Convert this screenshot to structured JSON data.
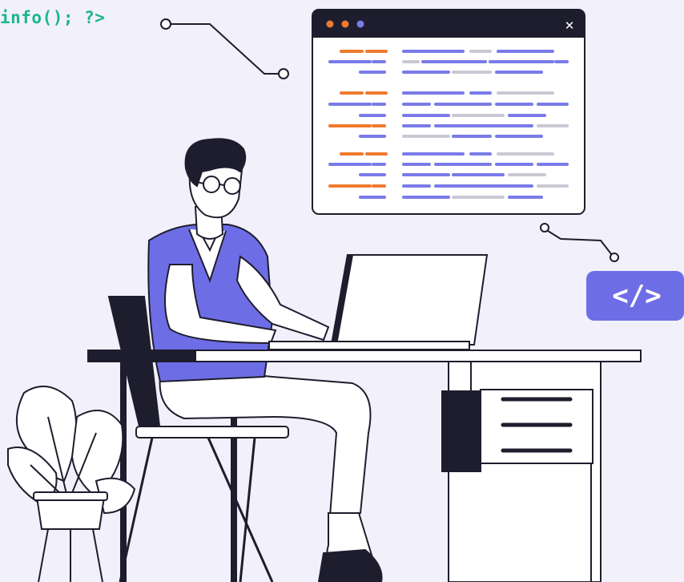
{
  "code_snippet": {
    "text": "info(); ?>"
  },
  "code_window": {
    "close_glyph": "✕",
    "dots": [
      "#f07a2f",
      "#f07a2f",
      "#7a7be8"
    ]
  },
  "badge": {
    "text": "</>"
  },
  "colors": {
    "background": "#f1f0fb",
    "accent_purple": "#6d6ee6",
    "accent_orange": "#f07a2f",
    "accent_green": "#1bb58f",
    "ink": "#1e1d2d"
  }
}
